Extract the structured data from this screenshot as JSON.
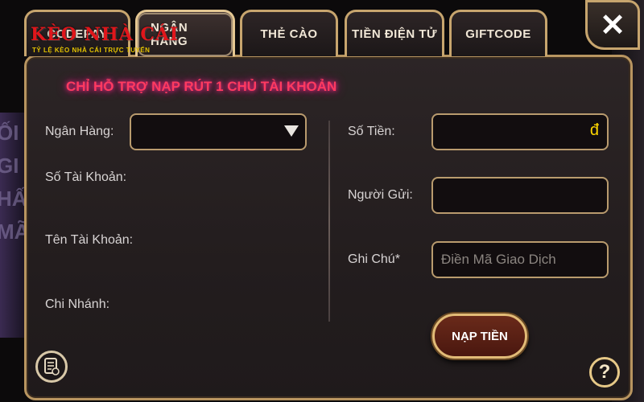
{
  "tabs": [
    {
      "label": "CODEPAY",
      "active": false
    },
    {
      "label": "NGÂN HÀNG",
      "active": true
    },
    {
      "label": "THẺ CÀO",
      "active": false
    },
    {
      "label": "TIỀN ĐIỆN TỬ",
      "active": false
    },
    {
      "label": "GIFTCODE",
      "active": false
    }
  ],
  "close_label": "✕",
  "watermark": {
    "title": "KÈO NHÀ CÁI",
    "subtitle": "TỶ LỆ KÈO NHÀ CÁI TRỰC TUYẾN"
  },
  "notice": "CHỈ HỖ TRỢ NẠP RÚT 1 CHỦ TÀI KHOẢN",
  "left_form": {
    "bank_label": "Ngân Hàng:",
    "account_number_label": "Số Tài Khoản:",
    "account_name_label": "Tên Tài Khoản:",
    "branch_label": "Chi Nhánh:"
  },
  "right_form": {
    "amount_label": "Số Tiền:",
    "currency_symbol": "đ",
    "sender_label": "Người Gửi:",
    "note_label": "Ghi Chú*",
    "note_placeholder": "Điền Mã Giao Dịch"
  },
  "submit_label": "NẠP TIỀN",
  "help_label": "?",
  "background_glimpse": [
    "ỐI",
    "GI",
    "HẤT",
    "MÃ"
  ]
}
